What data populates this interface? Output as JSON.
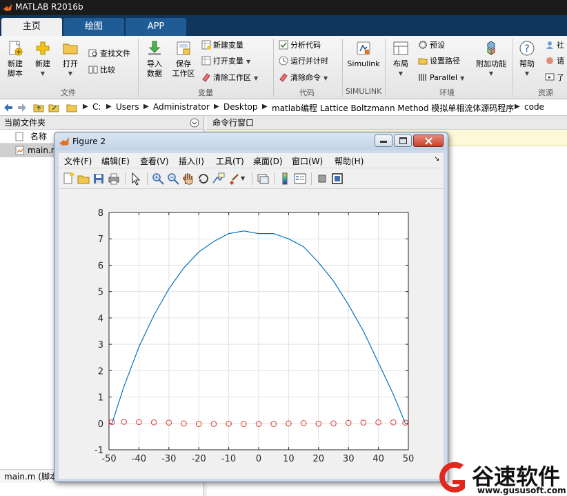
{
  "app": {
    "title": "MATLAB R2016b"
  },
  "tabs": [
    {
      "label": "主页",
      "active": true
    },
    {
      "label": "绘图",
      "active": false
    },
    {
      "label": "APP",
      "active": false
    }
  ],
  "ribbon": {
    "file_group": {
      "label": "文件",
      "new_script": "新建\n脚本",
      "new_script_l1": "新建",
      "new_script_l2": "脚本",
      "new": "新建",
      "open": "打开",
      "find_files": "查找文件",
      "compare": "比较"
    },
    "variable_group": {
      "label": "变量",
      "import_l1": "导入",
      "import_l2": "数据",
      "save_l1": "保存",
      "save_l2": "工作区",
      "new_variable": "新建变量",
      "open_variable": "打开变量",
      "clear_workspace": "清除工作区"
    },
    "code_group": {
      "label": "代码",
      "analyze": "分析代码",
      "run_time": "运行并计时",
      "clear_commands": "清除命令"
    },
    "simulink_group": {
      "label": "SIMULINK",
      "simulink": "Simulink"
    },
    "env_group": {
      "label": "环境",
      "layout": "布局",
      "preferences": "预设",
      "set_path": "设置路径",
      "parallel": "Parallel",
      "addons": "附加功能"
    },
    "resources_group": {
      "label": "资源",
      "help": "帮助",
      "community": "社",
      "request": "请",
      "learn": "了"
    }
  },
  "address": {
    "crumbs": [
      "C:",
      "Users",
      "Administrator",
      "Desktop",
      "matlab编程 Lattice Boltzmann Method 模拟单相流体源码程序",
      "code"
    ]
  },
  "left_panel": {
    "title": "当前文件夹",
    "col_name": "名称",
    "file": "main.m",
    "detail": "main.m  (脚本)"
  },
  "right_panel": {
    "title": "命令行窗口"
  },
  "figure": {
    "title": "Figure 2",
    "menus": [
      "文件(F)",
      "编辑(E)",
      "查看(V)",
      "插入(I)",
      "工具(T)",
      "桌面(D)",
      "窗口(W)",
      "帮助(H)"
    ]
  },
  "chart_data": {
    "type": "line",
    "title": "",
    "xlabel": "",
    "ylabel": "",
    "xlim": [
      -50,
      50
    ],
    "ylim": [
      -1,
      8
    ],
    "xticks": [
      -50,
      -40,
      -30,
      -20,
      -10,
      0,
      10,
      20,
      30,
      40,
      50
    ],
    "yticks": [
      -1,
      0,
      1,
      2,
      3,
      4,
      5,
      6,
      7,
      8
    ],
    "grid": true,
    "series": [
      {
        "style": "line",
        "color": "#0072bd",
        "x": [
          -49,
          -45,
          -40,
          -35,
          -30,
          -25,
          -20,
          -15,
          -10,
          -5,
          0,
          5,
          10,
          15,
          20,
          25,
          30,
          35,
          40,
          45,
          49
        ],
        "y": [
          0,
          1.4,
          2.9,
          4.1,
          5.1,
          5.9,
          6.5,
          6.9,
          7.2,
          7.3,
          7.2,
          7.2,
          7.0,
          6.7,
          6.1,
          5.4,
          4.5,
          3.5,
          2.3,
          1.1,
          0
        ]
      },
      {
        "style": "markers",
        "marker": "circle",
        "color": "#e0312b",
        "x": [
          -49,
          -45,
          -40,
          -35,
          -30,
          -25,
          -20,
          -15,
          -10,
          -5,
          0,
          5,
          10,
          15,
          20,
          25,
          30,
          35,
          40,
          45,
          49
        ],
        "y": [
          0.05,
          0.06,
          0.05,
          0.04,
          0.03,
          0.0,
          -0.02,
          -0.02,
          -0.01,
          -0.02,
          -0.02,
          -0.02,
          0.0,
          0.01,
          -0.01,
          0.0,
          0.02,
          0.03,
          0.04,
          0.04,
          0.03
        ]
      }
    ]
  },
  "watermark": {
    "text": "谷速软件",
    "url": "www.gususoft.com"
  },
  "colors": {
    "line_blue": "#0072bd",
    "marker_red": "#e0312b",
    "tab_blue": "#1f5c95",
    "titlebar": "#1b1b1b"
  }
}
